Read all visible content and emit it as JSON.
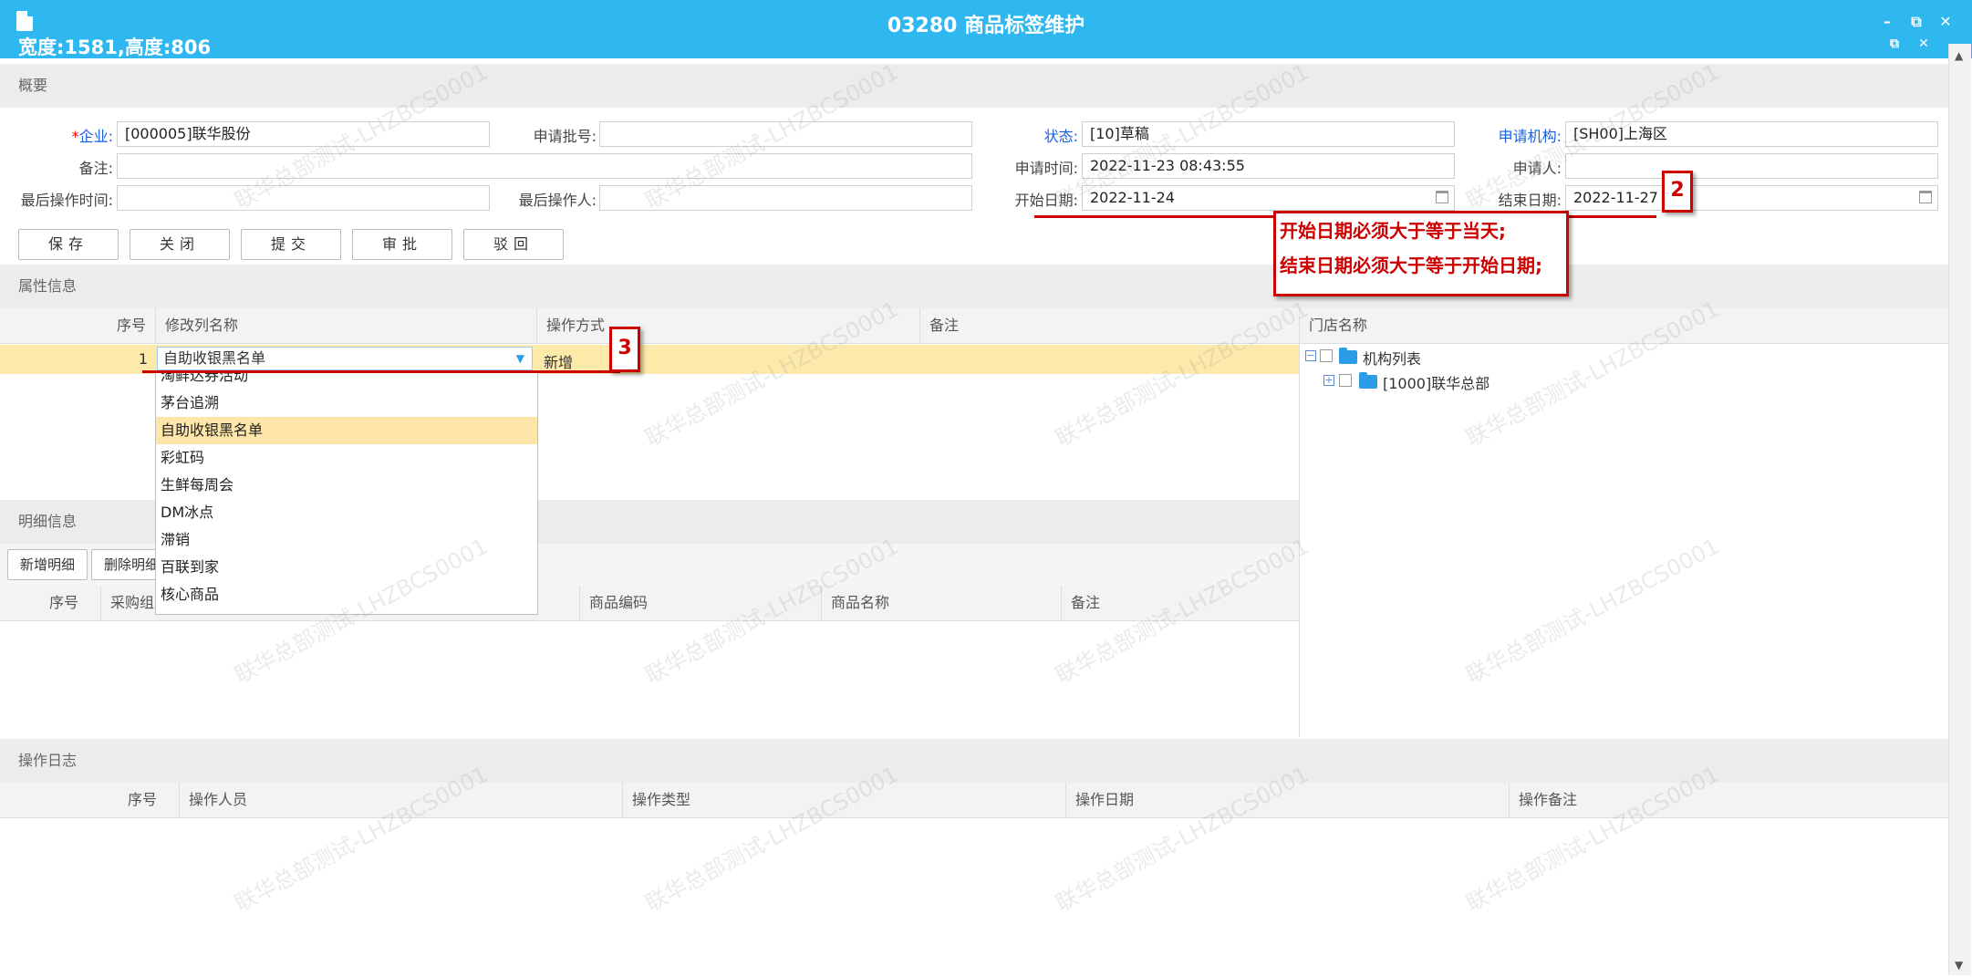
{
  "window": {
    "title": "03280 商品标签维护",
    "dims_text": "宽度:1581,高度:806",
    "controls": {
      "minimize": "–",
      "restore": "⧉",
      "close": "✕"
    }
  },
  "sections": {
    "overview": "概要",
    "attributes": "属性信息",
    "details": "明细信息",
    "log": "操作日志"
  },
  "form": {
    "company_label": "企业:",
    "company_value": "[000005]联华股份",
    "batch_label": "申请批号:",
    "batch_value": "",
    "status_label": "状态:",
    "status_value": "[10]草稿",
    "org_label": "申请机构:",
    "org_value": "[SH00]上海区",
    "remark_label": "备注:",
    "remark_value": "",
    "apply_time_label": "申请时间:",
    "apply_time_value": "2022-11-23 08:43:55",
    "applicant_label": "申请人:",
    "applicant_value": "",
    "last_time_label": "最后操作时间:",
    "last_time_value": "",
    "last_op_label": "最后操作人:",
    "last_op_value": "",
    "start_label": "开始日期:",
    "start_value": "2022-11-24",
    "end_label": "结束日期:",
    "end_value": "2022-11-27"
  },
  "toolbar": {
    "save": "保存",
    "close": "关闭",
    "submit": "提交",
    "approve": "审批",
    "reject": "驳回"
  },
  "attr_grid": {
    "headers": [
      "序号",
      "修改列名称",
      "操作方式",
      "备注"
    ],
    "row": {
      "index": "1",
      "column_name": "自助收银黑名单",
      "operation": "新增",
      "remark": ""
    }
  },
  "dropdown": {
    "items": [
      "淘鲜达券活动",
      "茅台追溯",
      "自助收银黑名单",
      "彩虹码",
      "生鲜每周会",
      "DM冰点",
      "滞销",
      "百联到家",
      "核心商品"
    ],
    "selected": "自助收银黑名单"
  },
  "store_tree": {
    "header": "门店名称",
    "root": "机构列表",
    "child": "[1000]联华总部"
  },
  "detail_toolbar": {
    "add": "新增明细",
    "delete": "删除明细"
  },
  "detail_grid": {
    "headers": [
      "序号",
      "采购组",
      "商品编码",
      "商品名称",
      "备注"
    ]
  },
  "log_grid": {
    "headers": [
      "序号",
      "操作人员",
      "操作类型",
      "操作日期",
      "操作备注"
    ]
  },
  "annotations": {
    "marker2": "2",
    "marker3": "3",
    "note_line1": "开始日期必须大于等于当天;",
    "note_line2": "结束日期必须大于等于开始日期;",
    "color": "#cc0000"
  },
  "watermark": "联华总部测试-LHZBCS0001"
}
